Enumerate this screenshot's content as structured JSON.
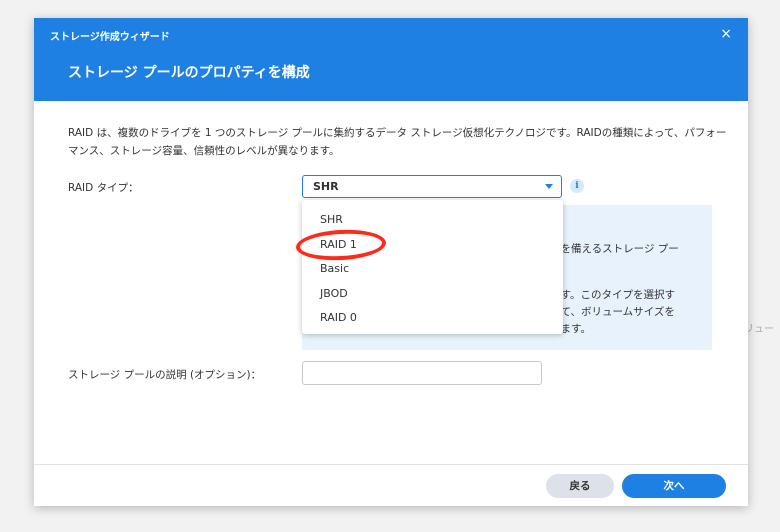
{
  "background": {
    "fragment_text": "リュー"
  },
  "dialog": {
    "wizard_title": "ストレージ作成ウィザード",
    "close_symbol": "×",
    "heading": "ストレージ プールのプロパティを構成",
    "description": "RAID は、複数のドライブを 1 つのストレージ プールに集約するデータ ストレージ仮想化テクノロジです。RAIDの種類によって、パフォーマンス、ストレージ容量、信頼性のレベルが異なります。",
    "raid_type": {
      "label": "RAID タイプ：",
      "selected": "SHR",
      "options": [
        "SHR",
        "RAID 1",
        "Basic",
        "JBOD",
        "RAID 0"
      ],
      "highlighted_option": "RAID 1"
    },
    "info_icon_symbol": "i",
    "info_panel": {
      "line1": "ブを備えるストレージ プー",
      "line2": "ます。このタイプを選択す",
      "line3": "せて、ボリュームサイズを",
      "line4": "きます。"
    },
    "pool_description": {
      "label": "ストレージ プールの説明 (オプション)：",
      "value": "",
      "placeholder": ""
    },
    "buttons": {
      "back": "戻る",
      "next": "次へ"
    }
  },
  "colors": {
    "accent": "#1e80e3",
    "highlight_ring": "#ff2a1a",
    "info_panel_bg": "#e8f2fc",
    "back_button_bg": "#dde2ea"
  }
}
